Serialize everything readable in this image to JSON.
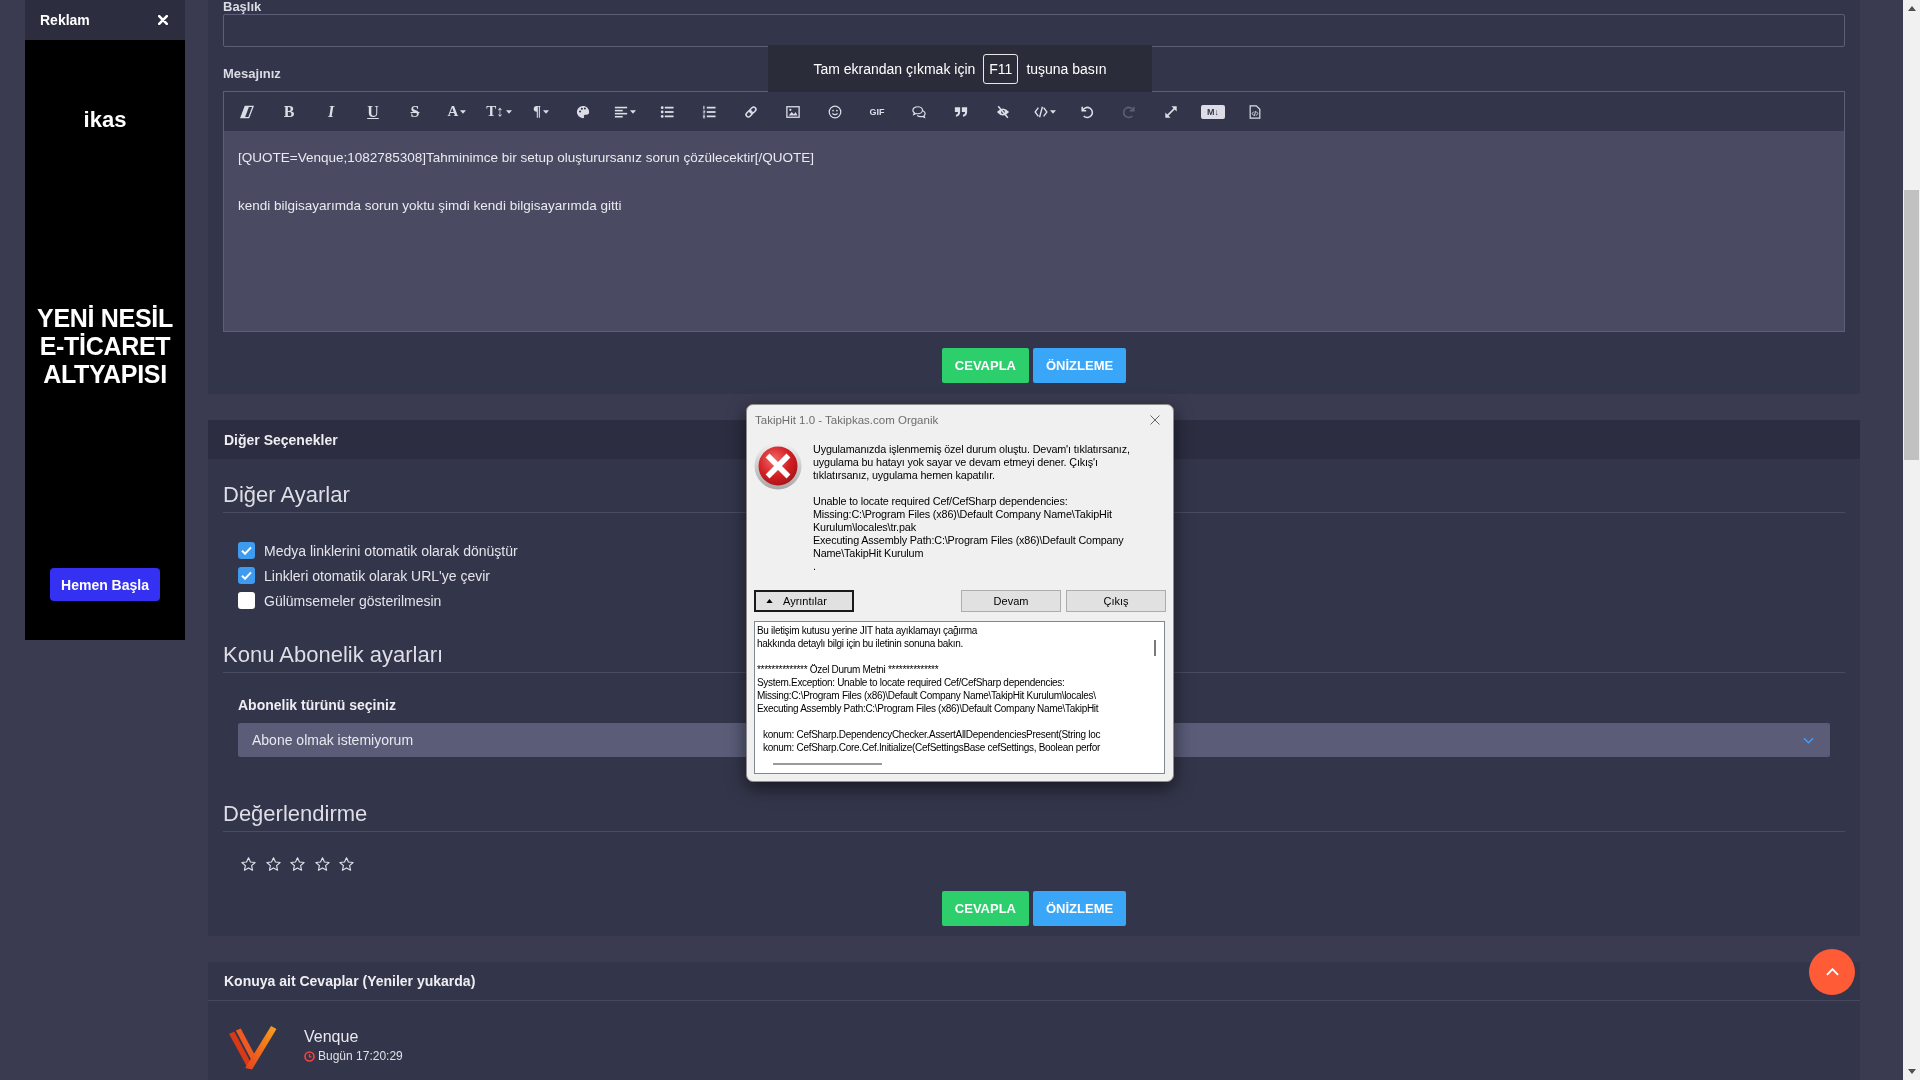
{
  "ad": {
    "title": "Reklam",
    "brand": "ikas",
    "headline": "YENİ NESİL\nE-TİCARET\nALTYAPISI",
    "button": "Hemen Başla"
  },
  "fullscreen_hint": {
    "before": "Tam ekrandan çıkmak için",
    "key": "F11",
    "after": "tuşuna basın"
  },
  "reply_form": {
    "title_label": "Başlık",
    "message_label": "Mesajınız",
    "toolbar": [
      {
        "kind": "icon",
        "dropdown": false,
        "disabled": false
      },
      {
        "kind": "bold",
        "label": "B",
        "dropdown": false,
        "disabled": false
      },
      {
        "kind": "italic",
        "label": "I",
        "dropdown": false,
        "disabled": false
      },
      {
        "kind": "underline",
        "label": "U",
        "dropdown": false,
        "disabled": false
      },
      {
        "kind": "strike",
        "label": "S",
        "dropdown": false,
        "disabled": false
      },
      {
        "kind": "glyph",
        "label": "A",
        "dropdown": true,
        "disabled": false
      },
      {
        "kind": "glyph",
        "label": "T↕",
        "dropdown": true,
        "disabled": false
      },
      {
        "kind": "glyph",
        "label": "¶",
        "dropdown": true,
        "disabled": false
      },
      {
        "kind": "icon",
        "dropdown": false,
        "disabled": false
      },
      {
        "kind": "icon",
        "dropdown": true,
        "disabled": false
      },
      {
        "kind": "icon",
        "dropdown": false,
        "disabled": false
      },
      {
        "kind": "icon",
        "dropdown": false,
        "disabled": false
      },
      {
        "kind": "icon",
        "dropdown": false,
        "disabled": false
      },
      {
        "kind": "icon",
        "dropdown": false,
        "disabled": false
      },
      {
        "kind": "icon",
        "dropdown": false,
        "disabled": false
      },
      {
        "kind": "small",
        "label": "GIF",
        "dropdown": false,
        "disabled": false
      },
      {
        "kind": "icon",
        "dropdown": false,
        "disabled": false
      },
      {
        "kind": "icon",
        "dropdown": false,
        "disabled": false
      },
      {
        "kind": "icon",
        "dropdown": false,
        "disabled": false
      },
      {
        "kind": "icon",
        "dropdown": true,
        "disabled": false
      },
      {
        "kind": "icon",
        "dropdown": false,
        "disabled": false
      },
      {
        "kind": "icon",
        "dropdown": false,
        "disabled": true
      },
      {
        "kind": "icon",
        "dropdown": false,
        "disabled": false
      },
      {
        "kind": "mark",
        "label": "M↓",
        "dropdown": false,
        "disabled": false
      },
      {
        "kind": "icon",
        "dropdown": false,
        "disabled": false
      }
    ],
    "message": "[QUOTE=Venque;1082785308]Tahminimce bir setup oluşturursanız sorun çözülecektir[/QUOTE]\n\nkendi bilgisayarımda sorun yoktu şimdi kendi bilgisayarımda gitti",
    "buttons": [
      {
        "label": "CEVAPLA",
        "kind": "submit"
      },
      {
        "label": "ÖNİZLEME",
        "kind": "preview"
      }
    ]
  },
  "options": {
    "header": "Diğer Seçenekler",
    "sections": [
      {
        "kind": "checkboxes",
        "title": "Diğer Ayarlar",
        "items": [
          {
            "label": "Medya linklerini otomatik olarak dönüştür",
            "checked": true
          },
          {
            "label": "Linkleri otomatik olarak URL'ye çevir",
            "checked": true
          },
          {
            "label": "Gülümsemeler gösterilmesin",
            "checked": false
          }
        ]
      },
      {
        "kind": "select",
        "title": "Konu Abonelik ayarları",
        "label": "Abonelik türünü seçiniz",
        "value": "Abone olmak istemiyorum"
      },
      {
        "kind": "rating",
        "title": "Değerlendirme",
        "stars": 0
      }
    ],
    "buttons": [
      {
        "label": "CEVAPLA",
        "kind": "submit"
      },
      {
        "label": "ÖNİZLEME",
        "kind": "preview"
      }
    ]
  },
  "replies": {
    "header": "Konuya ait Cevaplar (Yeniler yukarda)",
    "posts": [
      {
        "author": "Venque",
        "time": "Bugün 17:20:29"
      }
    ]
  },
  "dialog": {
    "title": "TakipHit 1.0 - Takipkas.com Organik",
    "message": [
      "Uygulamanızda işlenmemiş özel durum oluştu. Devam'ı tıklatırsanız,\nuygulama bu hatayı yok sayar ve devam etmeyi dener. Çıkış'ı\ntıklatırsanız, uygulama hemen kapatılır.",
      "Unable to locate required Cef/CefSharp dependencies:\nMissing:C:\\Program Files (x86)\\Default Company Name\\TakipHit\nKurulum\\locales\\tr.pak\nExecuting Assembly Path:C:\\Program Files (x86)\\Default Company\nName\\TakipHit Kurulum\n."
    ],
    "buttons": [
      {
        "label": "Ayrıntılar",
        "kind": "toggle",
        "expanded": true,
        "focused": true
      },
      {
        "label": "Devam",
        "kind": "plain",
        "focused": false
      },
      {
        "label": "Çıkış",
        "kind": "plain",
        "focused": false
      }
    ],
    "details": [
      {
        "kind": "text",
        "text": "Bu iletişim kutusu yerine JIT hata ayıklamayı çağırma\nhakkında detaylı bilgi için bu iletinin sonuna bakın."
      },
      {
        "kind": "text",
        "text": "************** Özel Durum Metni **************\nSystem.Exception: Unable to locate required Cef/CefSharp dependencies:\nMissing:C:\\Program Files (x86)\\Default Company Name\\TakipHit Kurulum\\locales\\\nExecuting Assembly Path:C:\\Program Files (x86)\\Default Company Name\\TakipHit"
      },
      {
        "kind": "stack",
        "text": "konum: CefSharp.DependencyChecker.AssertAllDependenciesPresent(String loc\nkonum: CefSharp.Core.Cef.Initialize(CefSettingsBase cefSettings, Boolean perfor"
      }
    ]
  }
}
